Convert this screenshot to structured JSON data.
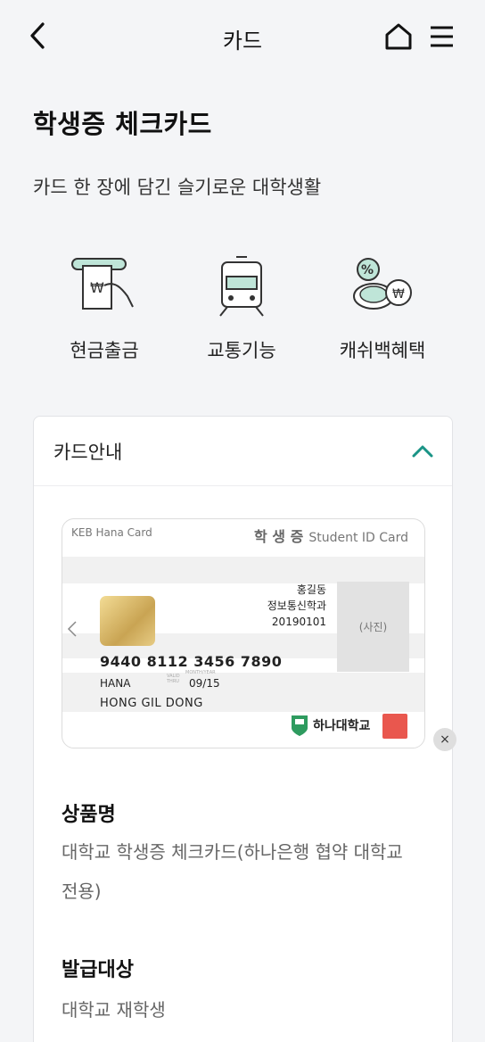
{
  "header": {
    "title": "카드",
    "back_icon": "chevron-left-icon",
    "home_icon": "home-icon",
    "menu_icon": "hamburger-menu-icon"
  },
  "hero": {
    "title": "학생증 체크카드",
    "subtitle": "카드 한 장에 담긴 슬기로운 대학생활"
  },
  "features": [
    {
      "label": "현금출금",
      "icon": "atm-withdraw-icon"
    },
    {
      "label": "교통기능",
      "icon": "train-icon"
    },
    {
      "label": "캐쉬백혜택",
      "icon": "coin-cashback-icon"
    }
  ],
  "card_guide": {
    "title": "카드안내",
    "toggle_icon": "chevron-up-icon",
    "card": {
      "brand": "KEB Hana Card",
      "kind_ko": "학 생 증",
      "kind_en": "Student ID Card",
      "name_ko": "홍길동",
      "dept": "정보통신학과",
      "student_no": "20190101",
      "photo": "(사진)",
      "number": "9440 8112 3456 7890",
      "bank": "HANA",
      "valid_thru": "VALID THRU",
      "month_year": "MONTH/YEAR",
      "expiry": "09/15",
      "holder": "HONG GIL DONG",
      "university": "하나대학교"
    },
    "close_label": "×",
    "product": {
      "heading": "상품명",
      "body": "대학교 학생증 체크카드(하나은행 협약 대학교 전용)"
    },
    "target": {
      "heading": "발급대상",
      "body": "대학교 재학생"
    }
  }
}
